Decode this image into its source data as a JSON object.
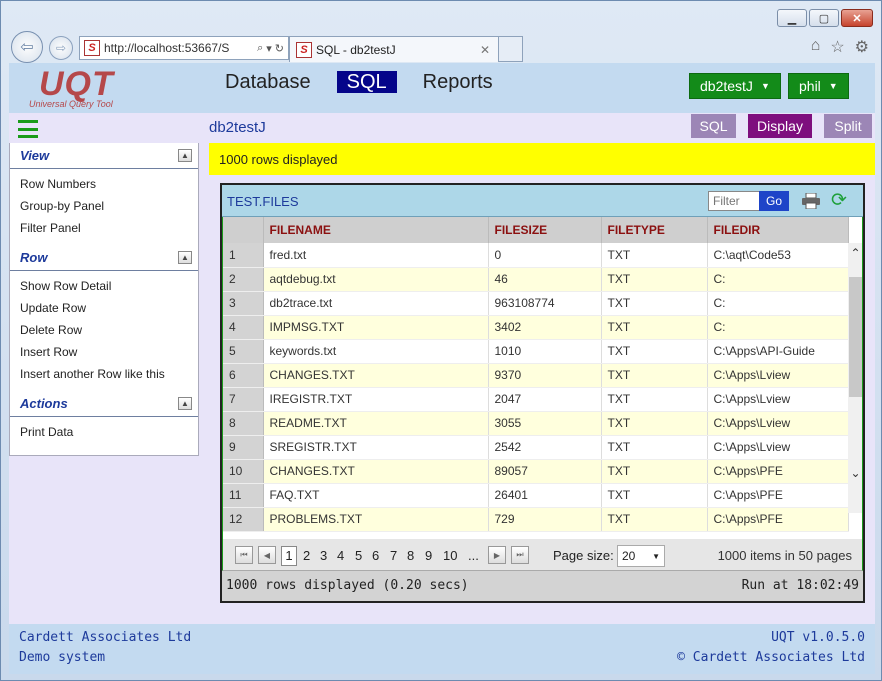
{
  "browser": {
    "address": "http://localhost:53667/S",
    "tab_title": "SQL - db2testJ",
    "favicon_letter": "S"
  },
  "app": {
    "logo": "UQT",
    "logo_sub": "Universal Query Tool",
    "nav": [
      "Database",
      "SQL",
      "Reports"
    ],
    "db_button": "db2testJ",
    "user_button": "phil",
    "db_label": "db2testJ",
    "modes": {
      "sql": "SQL",
      "display": "Display",
      "split": "Split"
    },
    "accent": "#05058a",
    "green": "#138b19"
  },
  "sidebar": {
    "sections": [
      {
        "title": "View",
        "items": [
          "Row Numbers",
          "Group-by Panel",
          "Filter Panel"
        ]
      },
      {
        "title": "Row",
        "items": [
          "Show Row Detail",
          "Update Row",
          "Delete Row",
          "Insert Row",
          "Insert another Row like this"
        ]
      },
      {
        "title": "Actions",
        "items": [
          "Print Data"
        ]
      }
    ]
  },
  "message": "1000 rows displayed",
  "grid": {
    "title": "TEST.FILES",
    "filter_placeholder": "Filter",
    "go_label": "Go",
    "columns": [
      "FILENAME",
      "FILESIZE",
      "FILETYPE",
      "FILEDIR"
    ],
    "rows": [
      [
        "1",
        "fred.txt",
        "0",
        "TXT",
        "C:\\aqt\\Code53"
      ],
      [
        "2",
        "aqtdebug.txt",
        "46",
        "TXT",
        "C:"
      ],
      [
        "3",
        "db2trace.txt",
        "963108774",
        "TXT",
        "C:"
      ],
      [
        "4",
        "IMPMSG.TXT",
        "3402",
        "TXT",
        "C:"
      ],
      [
        "5",
        "keywords.txt",
        "1010",
        "TXT",
        "C:\\Apps\\API-Guide"
      ],
      [
        "6",
        "CHANGES.TXT",
        "9370",
        "TXT",
        "C:\\Apps\\Lview"
      ],
      [
        "7",
        "IREGISTR.TXT",
        "2047",
        "TXT",
        "C:\\Apps\\Lview"
      ],
      [
        "8",
        "README.TXT",
        "3055",
        "TXT",
        "C:\\Apps\\Lview"
      ],
      [
        "9",
        "SREGISTR.TXT",
        "2542",
        "TXT",
        "C:\\Apps\\Lview"
      ],
      [
        "10",
        "CHANGES.TXT",
        "89057",
        "TXT",
        "C:\\Apps\\PFE"
      ],
      [
        "11",
        "FAQ.TXT",
        "26401",
        "TXT",
        "C:\\Apps\\PFE"
      ],
      [
        "12",
        "PROBLEMS.TXT",
        "729",
        "TXT",
        "C:\\Apps\\PFE"
      ]
    ],
    "pager": {
      "pages": [
        "1",
        "2",
        "3",
        "4",
        "5",
        "6",
        "7",
        "8",
        "9",
        "10",
        "..."
      ],
      "current": "1",
      "size_label": "Page size:",
      "size_value": "20",
      "info": "1000 items in 50 pages"
    },
    "status_left": "1000 rows displayed (0.20 secs)",
    "status_right": "Run at 18:02:49"
  },
  "footer": {
    "company": "Cardett Associates Ltd",
    "system": "Demo system",
    "version": "UQT v1.0.5.0",
    "copyright": "© Cardett Associates Ltd"
  }
}
